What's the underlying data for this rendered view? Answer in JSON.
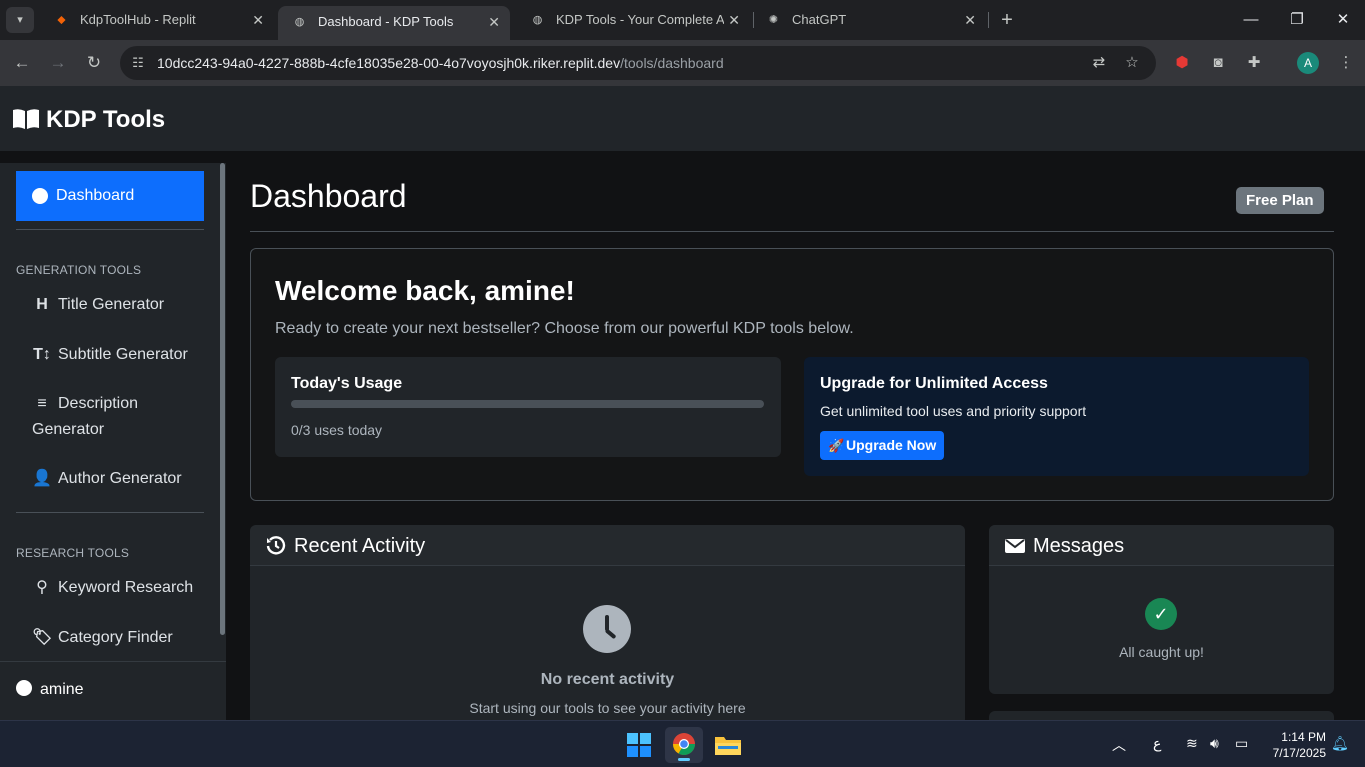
{
  "browser": {
    "tabs": [
      {
        "title": "KdpToolHub - Replit",
        "active": false
      },
      {
        "title": "Dashboard - KDP Tools",
        "active": true
      },
      {
        "title": "KDP Tools - Your Complete Am",
        "active": false
      },
      {
        "title": "ChatGPT",
        "active": false
      }
    ],
    "url_host": "10dcc243-94a0-4227-888b-4cfe18035e28-00-4o7voyosjh0k.riker.replit.dev",
    "url_path": "/tools/dashboard",
    "profile_initial": "A"
  },
  "app": {
    "brand": "KDP Tools"
  },
  "sidebar": {
    "active_item": "Dashboard",
    "sections": [
      {
        "heading": "GENERATION TOOLS",
        "items": [
          {
            "label": "Title Generator",
            "icon": "heading-icon"
          },
          {
            "label": "Subtitle Generator",
            "icon": "text-height-icon"
          },
          {
            "label": "Description",
            "label2": "Generator",
            "icon": "align-left-icon"
          },
          {
            "label": "Author Generator",
            "icon": "user-pen-icon"
          }
        ]
      },
      {
        "heading": "RESEARCH TOOLS",
        "items": [
          {
            "label": "Keyword Research",
            "icon": "search-icon"
          },
          {
            "label": "Category Finder",
            "icon": "tags-icon"
          }
        ]
      }
    ],
    "user": "amine"
  },
  "main": {
    "title": "Dashboard",
    "plan_badge": "Free Plan",
    "welcome": {
      "heading": "Welcome back, amine!",
      "subtitle": "Ready to create your next bestseller? Choose from our powerful KDP tools below."
    },
    "usage": {
      "heading": "Today's Usage",
      "used": 0,
      "limit": 3,
      "text": "0/3 uses today"
    },
    "upgrade": {
      "heading": "Upgrade for Unlimited Access",
      "text": "Get unlimited tool uses and priority support",
      "button": "Upgrade Now"
    },
    "recent_activity": {
      "heading": "Recent Activity",
      "empty_heading": "No recent activity",
      "empty_text": "Start using our tools to see your activity here"
    },
    "messages": {
      "heading": "Messages",
      "text": "All caught up!"
    }
  },
  "taskbar": {
    "time": "1:14 PM",
    "date": "7/17/2025",
    "lang": "ع"
  },
  "colors": {
    "accent": "#0d6efd",
    "success": "#198754",
    "badge": "#6c757d"
  }
}
